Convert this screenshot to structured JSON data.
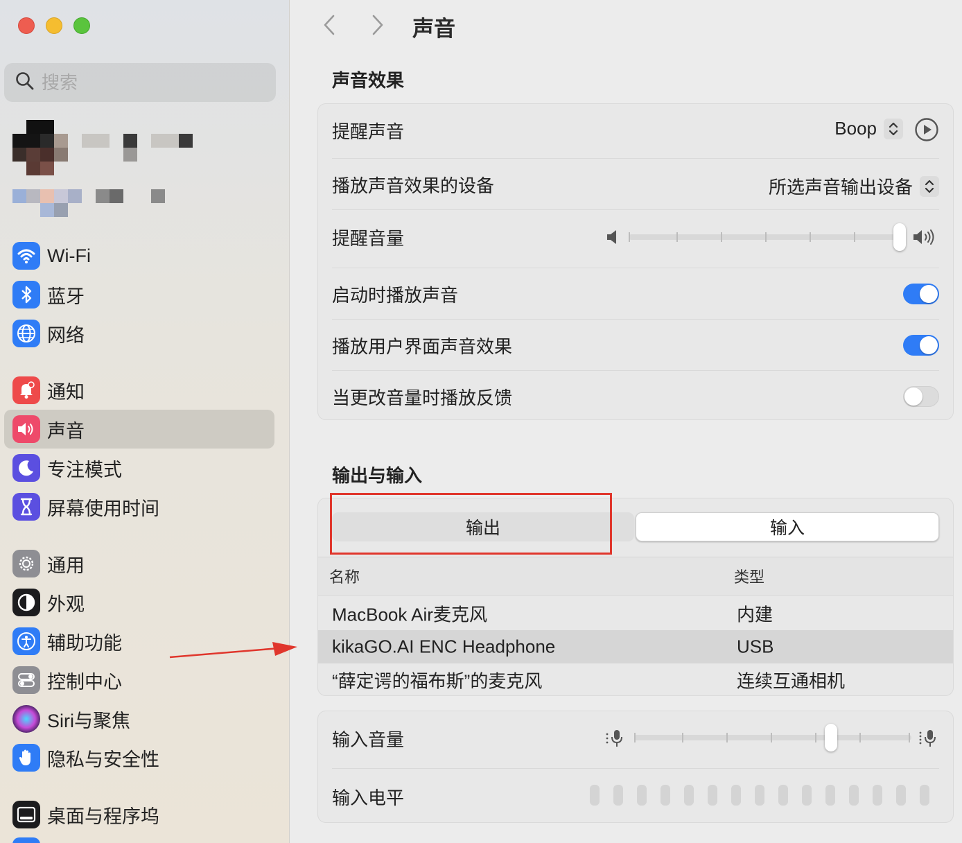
{
  "window": {
    "title": "声音"
  },
  "search": {
    "placeholder": "搜索"
  },
  "sidebar": {
    "items": [
      {
        "label": "Wi-Fi",
        "icon": "wifi-icon",
        "color": "#2f7cf6"
      },
      {
        "label": "蓝牙",
        "icon": "bluetooth-icon",
        "color": "#2f7cf6"
      },
      {
        "label": "网络",
        "icon": "globe-icon",
        "color": "#2f7cf6"
      },
      {
        "label": "通知",
        "icon": "bell-icon",
        "color": "#ee4a4a"
      },
      {
        "label": "声音",
        "icon": "speaker-icon",
        "color": "#ee4a6a",
        "selected": true
      },
      {
        "label": "专注模式",
        "icon": "moon-icon",
        "color": "#5b4fe0"
      },
      {
        "label": "屏幕使用时间",
        "icon": "hourglass-icon",
        "color": "#5b4fe0"
      },
      {
        "label": "通用",
        "icon": "gear-icon",
        "color": "#8e8e93"
      },
      {
        "label": "外观",
        "icon": "appearance-icon",
        "color": "#1c1c1e"
      },
      {
        "label": "辅助功能",
        "icon": "accessibility-icon",
        "color": "#2f7cf6"
      },
      {
        "label": "控制中心",
        "icon": "control-center-icon",
        "color": "#8e8e93"
      },
      {
        "label": "Siri与聚焦",
        "icon": "siri-icon",
        "color": "#7b3fb6"
      },
      {
        "label": "隐私与安全性",
        "icon": "hand-icon",
        "color": "#2f7cf6"
      },
      {
        "label": "桌面与程序坞",
        "icon": "dock-icon",
        "color": "#1c1c1e"
      }
    ]
  },
  "sound_effects": {
    "section_title": "声音效果",
    "alert_sound": {
      "label": "提醒声音",
      "value": "Boop"
    },
    "play_device": {
      "label": "播放声音效果的设备",
      "value": "所选声音输出设备"
    },
    "alert_volume": {
      "label": "提醒音量",
      "level": 1.0
    },
    "startup_sound": {
      "label": "启动时播放声音",
      "on": true
    },
    "ui_sounds": {
      "label": "播放用户界面声音效果",
      "on": true
    },
    "volume_feedback": {
      "label": "当更改音量时播放反馈",
      "on": false
    }
  },
  "io": {
    "section_title": "输出与输入",
    "tabs": {
      "output": "输出",
      "input": "输入"
    },
    "selected_tab": "input",
    "columns": {
      "name": "名称",
      "type": "类型"
    },
    "devices": [
      {
        "name": "MacBook Air麦克风",
        "type": "内建",
        "selected": false
      },
      {
        "name": "kikaGO.AI ENC Headphone",
        "type": "USB",
        "selected": true
      },
      {
        "name": "“薛定谔的福布斯”的麦克风",
        "type": "连续互通相机",
        "selected": false
      }
    ],
    "input_volume": {
      "label": "输入音量",
      "level": 0.72
    },
    "input_level": {
      "label": "输入电平",
      "segments": 15
    }
  },
  "annotation": {
    "highlight_color": "#e0362c"
  }
}
